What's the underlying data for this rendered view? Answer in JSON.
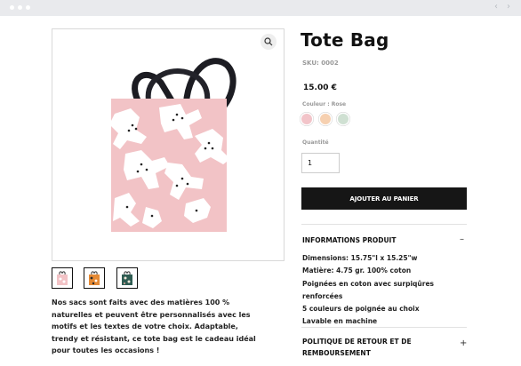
{
  "browser": {
    "back_icon": "chevron-left-icon",
    "forward_icon": "chevron-right-icon"
  },
  "gallery": {
    "zoom_icon": "magnifier-icon",
    "main_image": "pink tote bag with black handles and white animal print",
    "thumbnails": [
      {
        "label": "pink tote thumbnail"
      },
      {
        "label": "orange tote thumbnail"
      },
      {
        "label": "teal tote thumbnail"
      }
    ]
  },
  "description": "Nos sacs sont faits avec des matières 100 % naturelles et peuvent être personnalisés avec les motifs et les textes de votre choix. Adaptable, trendy et résistant, ce tote bag est le cadeau idéal pour toutes les occasions !",
  "product": {
    "title": "Tote Bag",
    "sku": "SKU: 0002",
    "price": "15.00 €",
    "color_label": "Couleur : Rose",
    "colors": [
      "#f2c4c9",
      "#f6d0b0",
      "#cfe0d2"
    ],
    "quantity_label": "Quantité",
    "quantity_value": "1",
    "add_to_cart": "AJOUTER AU PANIER"
  },
  "info": {
    "title": "INFORMATIONS PRODUIT",
    "toggle": "–",
    "lines": [
      "Dimensions: 15.75\"l x 15.25\"w",
      "Matière: 4.75 gr. 100% coton",
      "Poignées en coton avec surpiqûres renforcées",
      "5 couleurs de poignée au choix",
      "Lavable en machine"
    ]
  },
  "returns": {
    "title_line1": "POLITIQUE DE RETOUR ET DE",
    "title_line2": "REMBOURSEMENT",
    "toggle": "+"
  }
}
